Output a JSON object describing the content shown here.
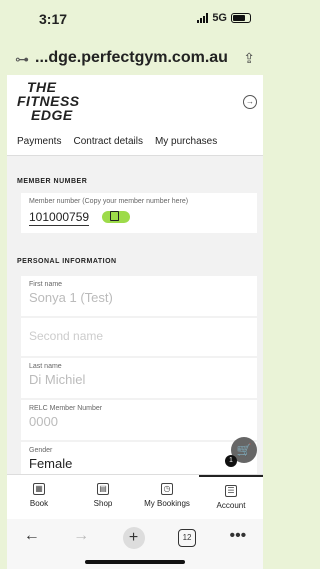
{
  "status": {
    "time": "3:17",
    "network": "5G"
  },
  "browser": {
    "url": "...dge.perfectgym.com.au"
  },
  "logo": {
    "line1": "THE",
    "line2": "FITNESS",
    "line3": "EDGE"
  },
  "tabs": [
    {
      "label": "Payments"
    },
    {
      "label": "Contract details"
    },
    {
      "label": "My purchases"
    }
  ],
  "member": {
    "section_title": "MEMBER NUMBER",
    "label": "Member number (Copy your member number here)",
    "number": "101000759"
  },
  "personal": {
    "section_title": "PERSONAL INFORMATION",
    "first_name_label": "First name",
    "first_name": "Sonya 1 (Test)",
    "second_name_placeholder": "Second name",
    "last_name_label": "Last name",
    "last_name": "Di Michiel",
    "relc_label": "RELC Member Number",
    "relc_value": "0000",
    "gender_label": "Gender",
    "gender_value": "Female"
  },
  "cart": {
    "count": "1"
  },
  "bottom_nav": [
    {
      "label": "Book",
      "icon": "calendar-icon"
    },
    {
      "label": "Shop",
      "icon": "shop-icon"
    },
    {
      "label": "My Bookings",
      "icon": "bookings-icon"
    },
    {
      "label": "Account",
      "icon": "account-icon"
    }
  ],
  "browser_toolbar": {
    "tab_count": "12"
  },
  "colors": {
    "accent_green": "#9ddb4a",
    "status_bg": "#eaf3d7"
  }
}
